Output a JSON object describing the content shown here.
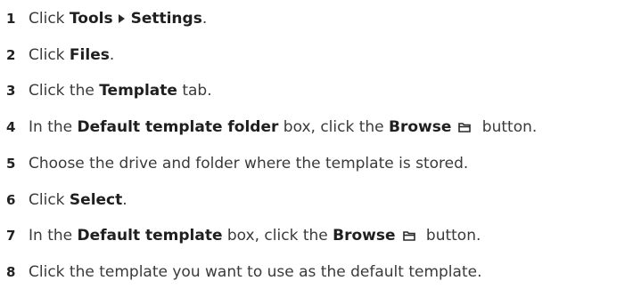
{
  "steps": [
    {
      "num": "1",
      "a": "Click ",
      "b1": "Tools",
      "b2": "Settings",
      "end": "."
    },
    {
      "num": "2",
      "a": "Click ",
      "b1": "Files",
      "end": "."
    },
    {
      "num": "3",
      "a": "Click the ",
      "b1": "Template",
      "end": " tab."
    },
    {
      "num": "4",
      "a": "In the ",
      "b1": "Default template folder",
      "mid": " box, click the ",
      "b2": "Browse",
      "end": " button."
    },
    {
      "num": "5",
      "a": "Choose the drive and folder where the template is stored."
    },
    {
      "num": "6",
      "a": "Click ",
      "b1": "Select",
      "end": "."
    },
    {
      "num": "7",
      "a": "In the ",
      "b1": "Default template",
      "mid": " box, click the ",
      "b2": "Browse",
      "end": " button."
    },
    {
      "num": "8",
      "a": "Click the template you want to use as the default template."
    }
  ],
  "icons": {
    "menu_arrow": "triangle-right-icon",
    "browse": "folder-icon"
  }
}
